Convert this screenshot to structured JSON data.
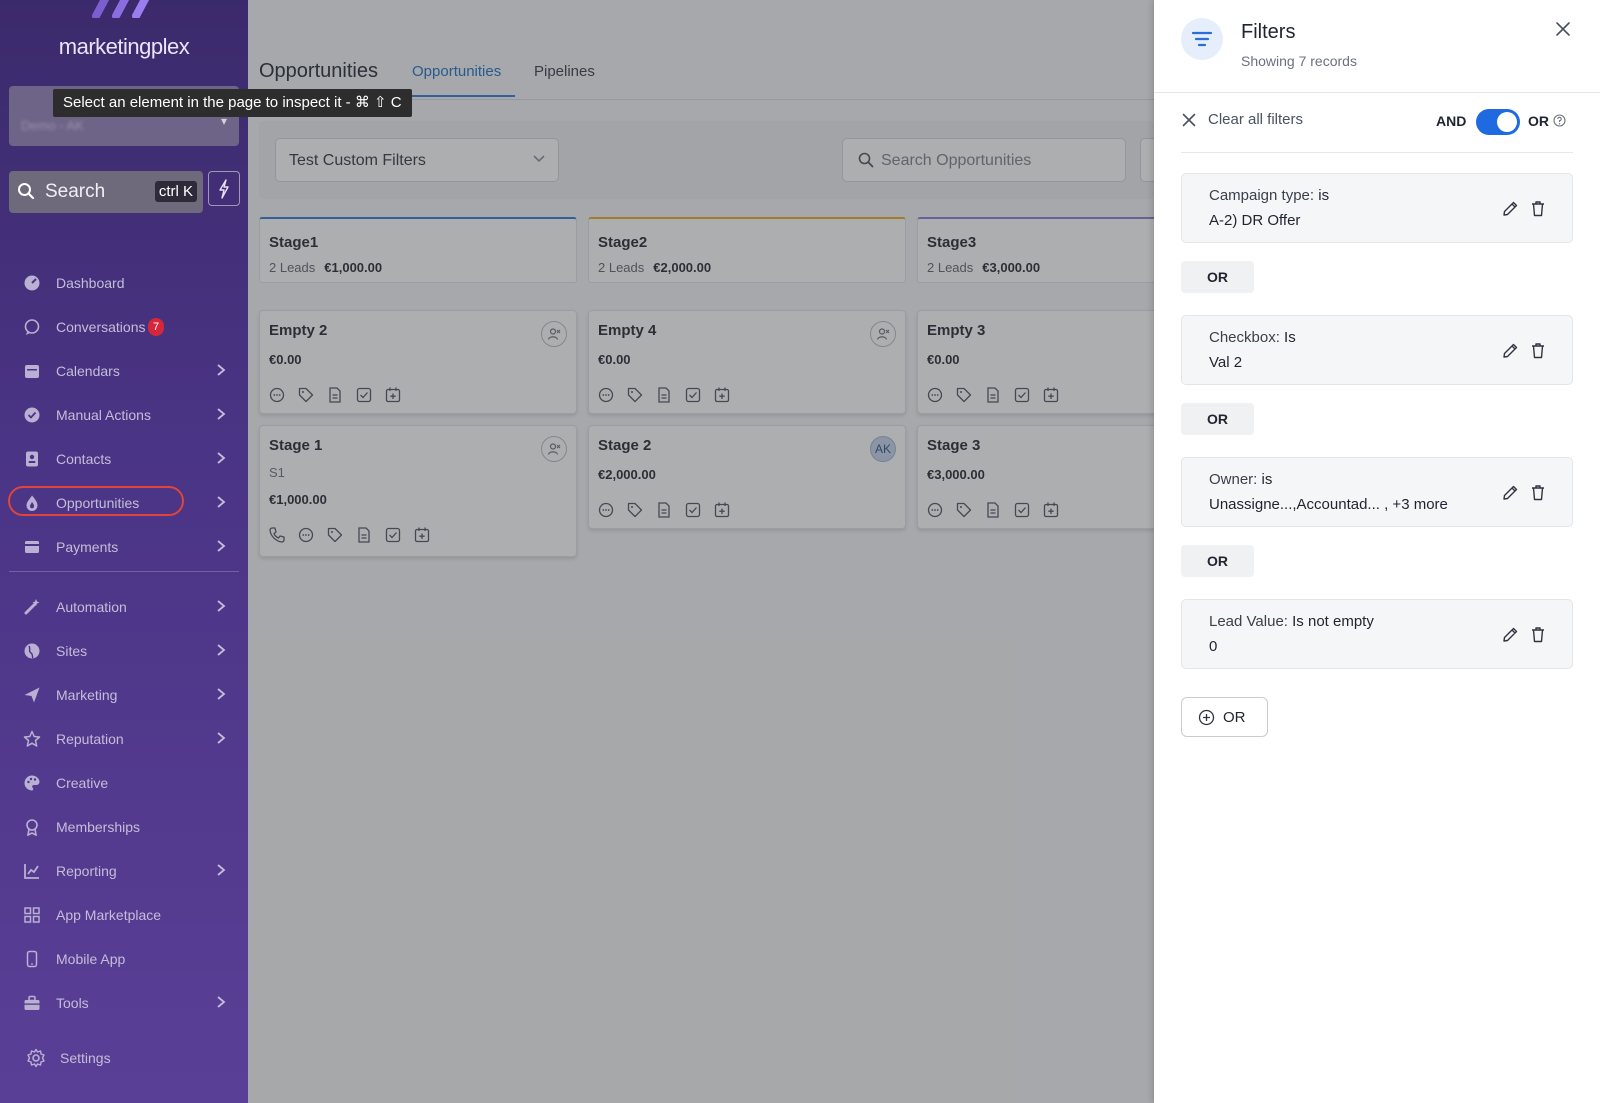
{
  "sidebar": {
    "logo_text": "marketingplex",
    "account_placeholder": "Demo - AK",
    "inspect_tooltip": "Select an element in the page to inspect it - ⌘ ⇧ C",
    "search_label": "Search",
    "search_shortcut": "ctrl K",
    "items": [
      {
        "label": "Dashboard",
        "icon": "dashboard-icon"
      },
      {
        "label": "Conversations",
        "icon": "chat-icon",
        "badge": "7"
      },
      {
        "label": "Calendars",
        "icon": "calendar-icon"
      },
      {
        "label": "Manual Actions",
        "icon": "check-badge-icon"
      },
      {
        "label": "Contacts",
        "icon": "contact-icon"
      },
      {
        "label": "Opportunities",
        "icon": "flame-icon"
      },
      {
        "label": "Payments",
        "icon": "payments-icon"
      },
      {
        "label": "Automation",
        "icon": "wand-icon"
      },
      {
        "label": "Sites",
        "icon": "globe-icon"
      },
      {
        "label": "Marketing",
        "icon": "send-icon"
      },
      {
        "label": "Reputation",
        "icon": "star-icon"
      },
      {
        "label": "Creative",
        "icon": "palette-icon"
      },
      {
        "label": "Memberships",
        "icon": "award-icon"
      },
      {
        "label": "Reporting",
        "icon": "chart-icon"
      },
      {
        "label": "App Marketplace",
        "icon": "grid-icon"
      },
      {
        "label": "Mobile App",
        "icon": "phone-icon"
      },
      {
        "label": "Tools",
        "icon": "toolbox-icon"
      },
      {
        "label": "Settings",
        "icon": "gear-icon"
      }
    ]
  },
  "header": {
    "title": "Opportunities",
    "tabs": [
      {
        "label": "Opportunities",
        "active": true
      },
      {
        "label": "Pipelines",
        "active": false
      }
    ]
  },
  "toolbar": {
    "pipeline_select": "Test Custom Filters",
    "search_placeholder": "Search Opportunities"
  },
  "stages": [
    {
      "name": "Stage1",
      "leads": "2 Leads",
      "amount": "€1,000.00",
      "accent": "#2b7bd8"
    },
    {
      "name": "Stage2",
      "leads": "2 Leads",
      "amount": "€2,000.00",
      "accent": "#f0a81c"
    },
    {
      "name": "Stage3",
      "leads": "2 Leads",
      "amount": "€3,000.00",
      "accent": "#8b7ad6"
    }
  ],
  "cards": [
    {
      "name": "Empty 2",
      "value": "€0.00",
      "avatar": ""
    },
    {
      "name": "Stage 1",
      "sub": "S1",
      "value": "€1,000.00",
      "avatar": ""
    },
    {
      "name": "Empty 4",
      "value": "€0.00",
      "avatar": ""
    },
    {
      "name": "Stage 2",
      "value": "€2,000.00",
      "avatar": "AK"
    },
    {
      "name": "Empty 3",
      "value": "€0.00",
      "avatar": ""
    },
    {
      "name": "Stage 3",
      "value": "€3,000.00",
      "avatar": ""
    }
  ],
  "panel": {
    "title": "Filters",
    "subtitle": "Showing 7 records",
    "clear_all": "Clear all filters",
    "and_label": "AND",
    "or_label": "OR",
    "logic_toggle_on": true,
    "filters": [
      {
        "field": "Campaign type:",
        "operator": "is",
        "value": "A-2) DR Offer"
      },
      {
        "field": "Checkbox:",
        "operator": "Is",
        "value": "Val 2"
      },
      {
        "field": "Owner:",
        "operator": "is",
        "value": "Unassigne...,Accountad... , +3 more"
      },
      {
        "field": "Lead Value:",
        "operator": "Is not empty",
        "value": "0"
      }
    ],
    "or_connector": "OR",
    "add_or_label": "OR"
  },
  "colors": {
    "accent": "#1f6ae0",
    "sidebar_bg": "#4a3485",
    "badge": "#d6263b"
  }
}
